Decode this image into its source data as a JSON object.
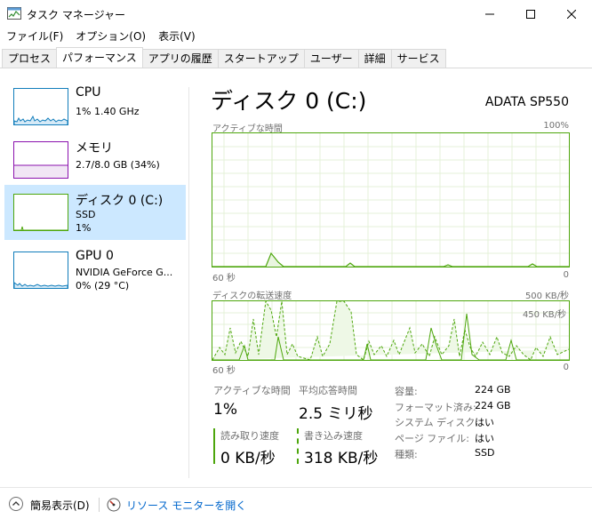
{
  "window": {
    "title": "タスク マネージャー"
  },
  "menu": [
    "ファイル(F)",
    "オプション(O)",
    "表示(V)"
  ],
  "tabs": [
    {
      "label": "プロセス",
      "active": false
    },
    {
      "label": "パフォーマンス",
      "active": true
    },
    {
      "label": "アプリの履歴",
      "active": false
    },
    {
      "label": "スタートアップ",
      "active": false
    },
    {
      "label": "ユーザー",
      "active": false
    },
    {
      "label": "詳細",
      "active": false
    },
    {
      "label": "サービス",
      "active": false
    }
  ],
  "resources": [
    {
      "name": "CPU",
      "line1": "1%  1.40 GHz",
      "line2": "",
      "color": "#117dbb",
      "icon": "cpu-graph-icon"
    },
    {
      "name": "メモリ",
      "line1": "2.7/8.0 GB (34%)",
      "line2": "",
      "color": "#8b12ae",
      "icon": "memory-graph-icon"
    },
    {
      "name": "ディスク 0 (C:)",
      "line1": "SSD",
      "line2": "1%",
      "color": "#4da60c",
      "icon": "disk-graph-icon",
      "selected": true
    },
    {
      "name": "GPU 0",
      "line1": "NVIDIA GeForce G...",
      "line2": "0% (29 °C)",
      "color": "#117dbb",
      "icon": "gpu-graph-icon"
    }
  ],
  "detail": {
    "title": "ディスク 0 (C:)",
    "model": "ADATA SP550",
    "active_time_graph": {
      "label": "アクティブな時間",
      "max": "100%",
      "time_label": "60 秒",
      "min": "0"
    },
    "transfer_graph": {
      "label": "ディスクの転送速度",
      "max": "500 KB/秒",
      "inner_max": "450 KB/秒",
      "time_label": "60 秒",
      "min": "0"
    }
  },
  "stats": {
    "active_time": {
      "label": "アクティブな時間",
      "value": "1%"
    },
    "avg_response": {
      "label": "平均応答時間",
      "value": "2.5 ミリ秒"
    },
    "read_speed": {
      "label": "読み取り速度",
      "value": "0 KB/秒"
    },
    "write_speed": {
      "label": "書き込み速度",
      "value": "318 KB/秒"
    }
  },
  "properties": [
    {
      "label": "容量:",
      "value": "224 GB"
    },
    {
      "label": "フォーマット済み:",
      "value": "224 GB"
    },
    {
      "label": "システム ディスク:",
      "value": "はい"
    },
    {
      "label": "ページ ファイル:",
      "value": "はい"
    },
    {
      "label": "種類:",
      "value": "SSD"
    }
  ],
  "footer": {
    "fewer_details": "簡易表示(D)",
    "resource_monitor": "リソース モニターを開く"
  },
  "colors": {
    "disk_accent": "#4da60c",
    "selected_bg": "#cce8ff",
    "link": "#0066cc"
  }
}
